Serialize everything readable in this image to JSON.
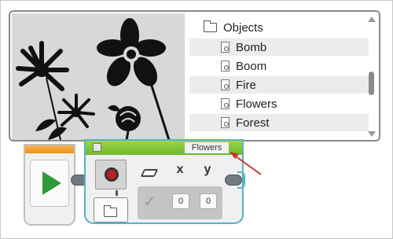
{
  "file_browser": {
    "header": {
      "icon": "folder-icon",
      "label": "Objects"
    },
    "items": [
      {
        "label": "Bomb",
        "icon": "file-icon"
      },
      {
        "label": "Boom",
        "icon": "file-icon"
      },
      {
        "label": "Fire",
        "icon": "file-icon"
      },
      {
        "label": "Flowers",
        "icon": "file-icon"
      },
      {
        "label": "Forest",
        "icon": "file-icon"
      }
    ],
    "preview": {
      "description_icon": "flowers-image"
    }
  },
  "program": {
    "start_block": {
      "icon": "play-icon",
      "accent": "#f0901a",
      "play_color": "#2e9a38"
    },
    "display_block": {
      "file_label": "Flowers",
      "accent": "#6fb82a",
      "border": "#52b5c4",
      "mode_icon": "display-image-icon",
      "params": {
        "clear_icon": "eraser-icon",
        "clear_state": "check-icon",
        "x_label": "x",
        "y_label": "y",
        "x_value": "0",
        "y_value": "0"
      }
    }
  },
  "annotation": {
    "arrow_color": "#c0392b"
  }
}
